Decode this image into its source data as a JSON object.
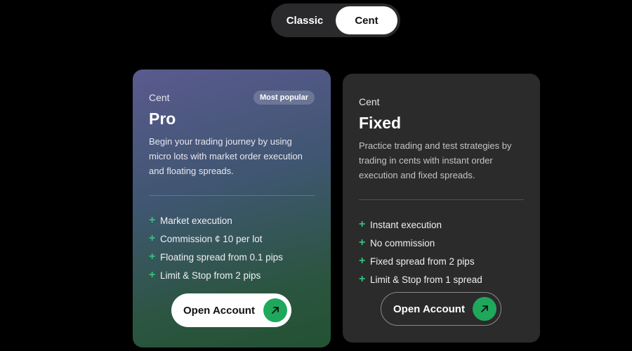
{
  "account_type_toggle": {
    "options": [
      "Classic",
      "Cent"
    ],
    "selected": "Cent"
  },
  "cards": [
    {
      "category": "Cent",
      "badge": "Most popular",
      "title": "Pro",
      "description": "Begin your trading journey by using micro lots with market order execution and floating spreads.",
      "features": [
        "Market execution",
        "Commission ¢ 10 per lot",
        "Floating spread from 0.1 pips",
        "Limit & Stop from 2 pips"
      ],
      "cta_label": "Open Account",
      "feature_icon": "plus-icon",
      "cta_icon": "arrow-up-right-icon"
    },
    {
      "category": "Cent",
      "title": "Fixed",
      "description": "Practice trading and test strategies by trading in cents with instant order execution and fixed spreads.",
      "features": [
        "Instant execution",
        "No commission",
        "Fixed spread from 2 pips",
        "Limit & Stop from 1 spread"
      ],
      "cta_label": "Open Account",
      "feature_icon": "plus-icon",
      "cta_icon": "arrow-up-right-icon"
    }
  ],
  "colors": {
    "accent_green": "#1fa85c",
    "plus_green": "#33c27a",
    "background": "#000000",
    "card_dark": "#2b2b2c"
  }
}
